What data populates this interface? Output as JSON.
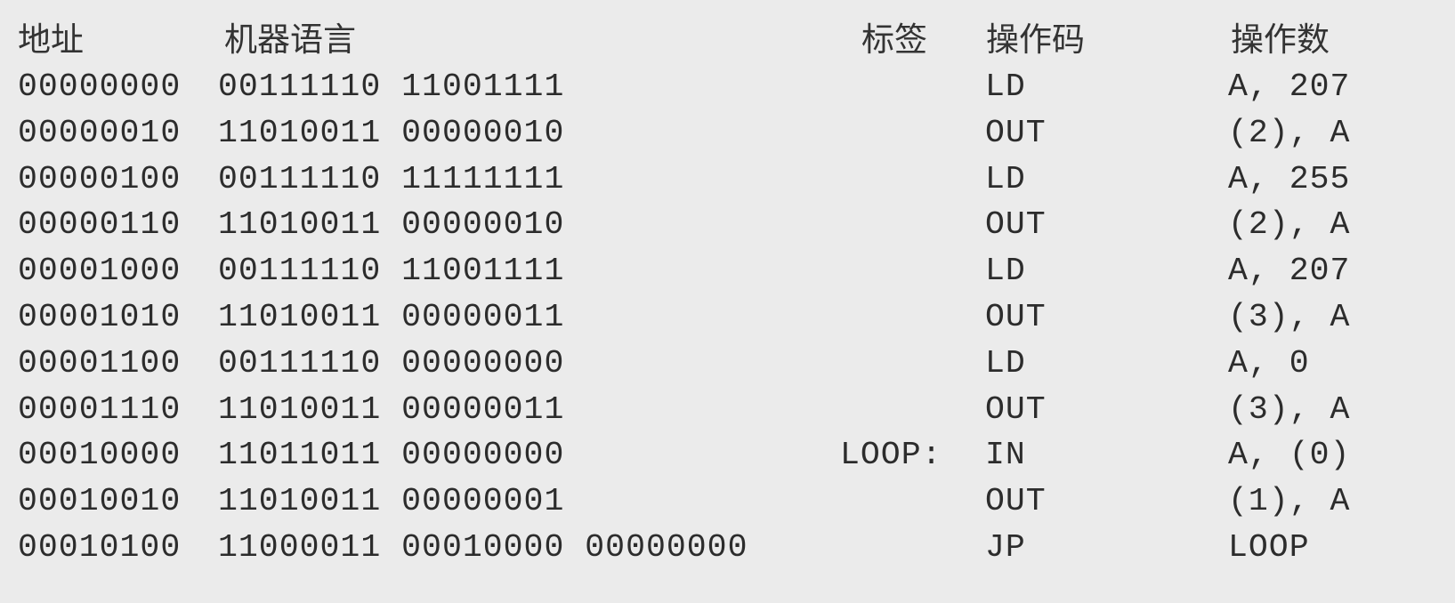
{
  "headers": {
    "address": "地址",
    "machine": "机器语言",
    "label": "标签",
    "opcode": "操作码",
    "operand": "操作数"
  },
  "rows": [
    {
      "address": "00000000",
      "machine": "00111110 11001111",
      "label": "",
      "opcode": "LD",
      "operand": "A, 207"
    },
    {
      "address": "00000010",
      "machine": "11010011 00000010",
      "label": "",
      "opcode": "OUT",
      "operand": "(2), A"
    },
    {
      "address": "00000100",
      "machine": "00111110 11111111",
      "label": "",
      "opcode": "LD",
      "operand": "A, 255"
    },
    {
      "address": "00000110",
      "machine": "11010011 00000010",
      "label": "",
      "opcode": "OUT",
      "operand": "(2), A"
    },
    {
      "address": "00001000",
      "machine": "00111110 11001111",
      "label": "",
      "opcode": "LD",
      "operand": "A, 207"
    },
    {
      "address": "00001010",
      "machine": "11010011 00000011",
      "label": "",
      "opcode": "OUT",
      "operand": "(3), A"
    },
    {
      "address": "00001100",
      "machine": "00111110 00000000",
      "label": "",
      "opcode": "LD",
      "operand": "A, 0"
    },
    {
      "address": "00001110",
      "machine": "11010011 00000011",
      "label": "",
      "opcode": "OUT",
      "operand": "(3), A"
    },
    {
      "address": "00010000",
      "machine": "11011011 00000000",
      "label": "LOOP:",
      "opcode": "IN",
      "operand": "A, (0)"
    },
    {
      "address": "00010010",
      "machine": "11010011 00000001",
      "label": "",
      "opcode": "OUT",
      "operand": "(1), A"
    },
    {
      "address": "00010100",
      "machine": "11000011 00010000 00000000",
      "label": "",
      "opcode": "JP",
      "operand": "LOOP"
    }
  ]
}
